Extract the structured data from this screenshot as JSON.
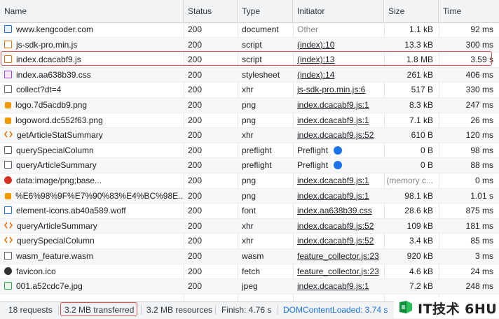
{
  "columns": {
    "name": "Name",
    "status": "Status",
    "type": "Type",
    "initiator": "Initiator",
    "size": "Size",
    "time": "Time"
  },
  "rows": [
    {
      "name": "www.kengcoder.com",
      "status": "200",
      "type": "document",
      "initiator": "Other",
      "size": "1.1 kB",
      "time": "92 ms",
      "icon": "document-icon"
    },
    {
      "name": "js-sdk-pro.min.js",
      "status": "200",
      "type": "script",
      "initiator": "(index):10",
      "size": "13.3 kB",
      "time": "300 ms",
      "icon": "script-icon"
    },
    {
      "name": "index.dcacabf9.js",
      "status": "200",
      "type": "script",
      "initiator": "(index):13",
      "size": "1.8 MB",
      "time": "3.59 s",
      "icon": "script-icon"
    },
    {
      "name": "index.aa638b39.css",
      "status": "200",
      "type": "stylesheet",
      "initiator": "(index):14",
      "size": "261 kB",
      "time": "406 ms",
      "icon": "stylesheet-icon"
    },
    {
      "name": "collect?dt=4",
      "status": "200",
      "type": "xhr",
      "initiator": "js-sdk-pro.min.js:6",
      "size": "517 B",
      "time": "330 ms",
      "icon": "xhr-icon"
    },
    {
      "name": "logo.7d5acdb9.png",
      "status": "200",
      "type": "png",
      "initiator": "index.dcacabf9.js:1",
      "size": "8.3 kB",
      "time": "247 ms",
      "icon": "image-icon"
    },
    {
      "name": "logoword.dc552f63.png",
      "status": "200",
      "type": "png",
      "initiator": "index.dcacabf9.js:1",
      "size": "7.1 kB",
      "time": "26 ms",
      "icon": "image-icon"
    },
    {
      "name": "getArticleStatSummary",
      "status": "200",
      "type": "xhr",
      "initiator": "index.dcacabf9.js:52",
      "size": "610 B",
      "time": "120 ms",
      "icon": "api-icon"
    },
    {
      "name": "querySpecialColumn",
      "status": "200",
      "type": "preflight",
      "initiator": "Preflight",
      "size": "0 B",
      "time": "98 ms",
      "icon": "xhr-icon"
    },
    {
      "name": "queryArticleSummary",
      "status": "200",
      "type": "preflight",
      "initiator": "Preflight",
      "size": "0 B",
      "time": "88 ms",
      "icon": "xhr-icon"
    },
    {
      "name": "data:image/png;base...",
      "status": "200",
      "type": "png",
      "initiator": "index.dcacabf9.js:1",
      "size": "(memory c...",
      "time": "0 ms",
      "icon": "data-image-icon"
    },
    {
      "name": "%E6%98%9F%E7%90%83%E4%BC%98E...",
      "status": "200",
      "type": "png",
      "initiator": "index.dcacabf9.js:1",
      "size": "98.1 kB",
      "time": "1.01 s",
      "icon": "image-icon"
    },
    {
      "name": "element-icons.ab40a589.woff",
      "status": "200",
      "type": "font",
      "initiator": "index.aa638b39.css",
      "size": "28.6 kB",
      "time": "875 ms",
      "icon": "font-icon"
    },
    {
      "name": "queryArticleSummary",
      "status": "200",
      "type": "xhr",
      "initiator": "index.dcacabf9.js:52",
      "size": "109 kB",
      "time": "181 ms",
      "icon": "api-icon"
    },
    {
      "name": "querySpecialColumn",
      "status": "200",
      "type": "xhr",
      "initiator": "index.dcacabf9.js:52",
      "size": "3.4 kB",
      "time": "85 ms",
      "icon": "api-icon"
    },
    {
      "name": "wasm_feature.wasm",
      "status": "200",
      "type": "wasm",
      "initiator": "feature_collector.js:23",
      "size": "920 kB",
      "time": "3 ms",
      "icon": "wasm-icon"
    },
    {
      "name": "favicon.ico",
      "status": "200",
      "type": "fetch",
      "initiator": "feature_collector.js:23",
      "size": "4.6 kB",
      "time": "24 ms",
      "icon": "favicon-icon"
    },
    {
      "name": "001.a52cdc7e.jpg",
      "status": "200",
      "type": "jpeg",
      "initiator": "index.dcacabf9.js:1",
      "size": "7.2 kB",
      "time": "248 ms",
      "icon": "jpeg-icon"
    }
  ],
  "footer": {
    "requests": "18 requests",
    "transferred": "3.2 MB transferred",
    "resources": "3.2 MB resources",
    "finish": "Finish: 4.76 s",
    "dom_loaded": "DOMContentLoaded: 3.74 s"
  },
  "watermark": {
    "text": "IT技术 6HU"
  },
  "colors": {
    "highlight": "#d9534f",
    "link_blue": "#1a73e8"
  }
}
